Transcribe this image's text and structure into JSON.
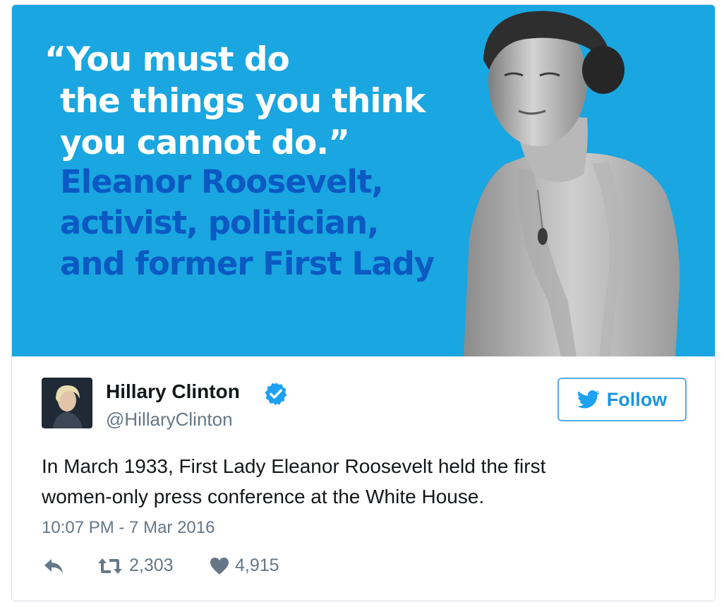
{
  "media": {
    "quote_lines": [
      "“You must do",
      "the things you think",
      "you cannot do.”"
    ],
    "attribution_lines": [
      "Eleanor Roosevelt,",
      "activist, politician,",
      "and former First Lady"
    ],
    "background_color": "#1aa6e0",
    "attribution_color": "#0b59c2"
  },
  "author": {
    "name": "Hillary Clinton",
    "handle": "@HillaryClinton",
    "verified_icon": "verified-badge-icon"
  },
  "follow_button": {
    "label": "Follow",
    "icon": "twitter-bird-icon",
    "color": "#1b95e0"
  },
  "tweet": {
    "text_lines": [
      "In March 1933, First Lady Eleanor Roosevelt held the first",
      "women-only press conference at the White House."
    ],
    "timestamp": "10:07 PM - 7 Mar 2016"
  },
  "actions": {
    "reply_icon": "reply-icon",
    "retweet_icon": "retweet-icon",
    "retweet_count": "2,303",
    "like_icon": "heart-icon",
    "like_count": "4,915"
  }
}
